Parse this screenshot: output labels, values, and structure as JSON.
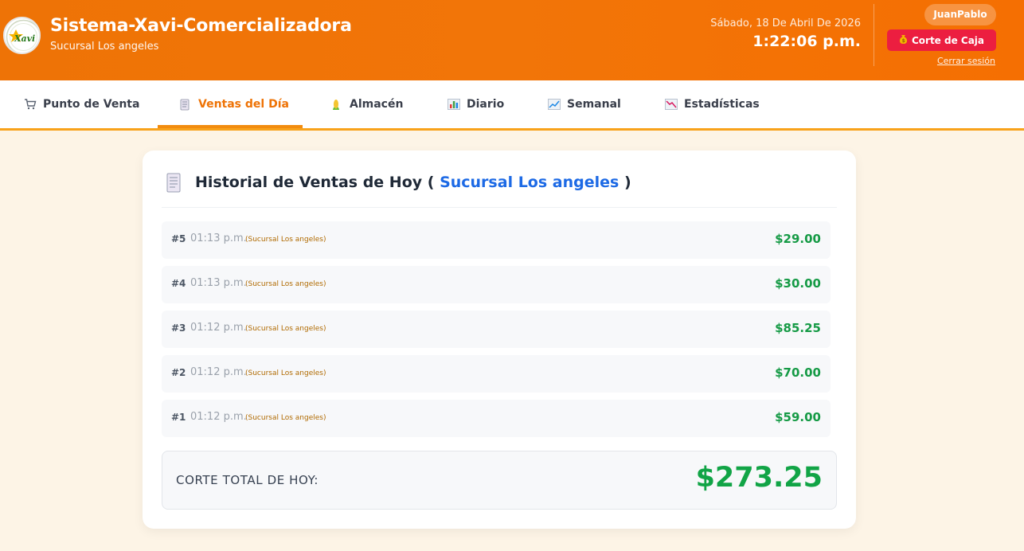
{
  "header": {
    "title": "Sistema-Xavi-Comercializadora",
    "subtitle": "Sucursal Los angeles",
    "logo_text": "Xavi",
    "date": "Sábado, 18 De Abril De 2026",
    "time": "1:22:06 p.m.",
    "user": "JuanPablo",
    "corte_label": "Corte de Caja",
    "logout_label": "Cerrar sesión"
  },
  "nav": {
    "tabs": [
      {
        "label": "Punto de Venta",
        "icon": "cart-icon"
      },
      {
        "label": "Ventas del Día",
        "icon": "receipt-icon",
        "active": true
      },
      {
        "label": "Almacén",
        "icon": "corn-icon"
      },
      {
        "label": "Diario",
        "icon": "bar-chart-icon"
      },
      {
        "label": "Semanal",
        "icon": "chart-up-icon"
      },
      {
        "label": "Estadísticas",
        "icon": "chart-down-icon"
      }
    ]
  },
  "card": {
    "title_prefix": "Historial de Ventas de Hoy (",
    "branch": "Sucursal Los angeles",
    "title_suffix": ")",
    "sales": [
      {
        "num": "#5",
        "time": "01:13 p.m.",
        "branch": "(Sucursal Los angeles)",
        "amount": "$29.00"
      },
      {
        "num": "#4",
        "time": "01:13 p.m.",
        "branch": "(Sucursal Los angeles)",
        "amount": "$30.00"
      },
      {
        "num": "#3",
        "time": "01:12 p.m.",
        "branch": "(Sucursal Los angeles)",
        "amount": "$85.25"
      },
      {
        "num": "#2",
        "time": "01:12 p.m.",
        "branch": "(Sucursal Los angeles)",
        "amount": "$70.00"
      },
      {
        "num": "#1",
        "time": "01:12 p.m.",
        "branch": "(Sucursal Los angeles)",
        "amount": "$59.00"
      }
    ],
    "total_label": "CORTE TOTAL DE HOY:",
    "total_amount": "$273.25"
  },
  "colors": {
    "header": "#f27508",
    "accent": "#ee7306",
    "corte_button": "#ec1e40",
    "amount_green": "#159a45",
    "branch_blue": "#1d6ae5"
  }
}
